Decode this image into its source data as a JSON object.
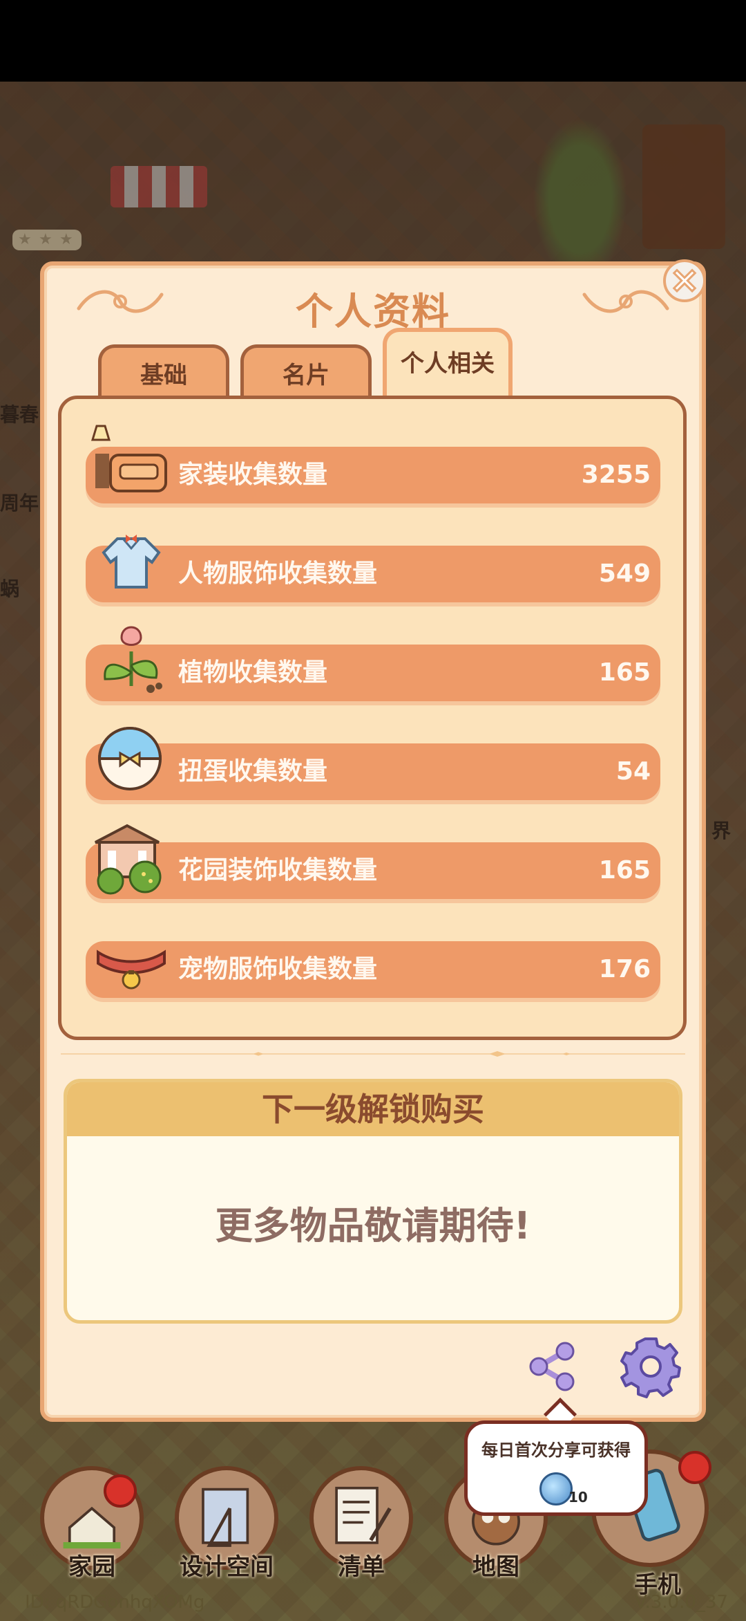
{
  "panel": {
    "title": "个人资料"
  },
  "side_labels": [
    "暮春",
    "周年",
    "蜗",
    "界"
  ],
  "tabs": [
    {
      "label": "基础",
      "active": false
    },
    {
      "label": "名片",
      "active": false
    },
    {
      "label": "个人相关",
      "active": true
    }
  ],
  "collection_rows": [
    {
      "label": "家装收集数量",
      "value": "3255",
      "icon": "sofa-lamp-icon"
    },
    {
      "label": "人物服饰收集数量",
      "value": "549",
      "icon": "shirt-icon"
    },
    {
      "label": "植物收集数量",
      "value": "165",
      "icon": "tulip-sprout-icon"
    },
    {
      "label": "扭蛋收集数量",
      "value": "54",
      "icon": "capsule-icon"
    },
    {
      "label": "花园装饰收集数量",
      "value": "165",
      "icon": "garden-pavilion-icon"
    },
    {
      "label": "宠物服饰收集数量",
      "value": "176",
      "icon": "pet-collar-icon"
    }
  ],
  "unlock": {
    "header": "下一级解锁购买",
    "body": "更多物品敬请期待!"
  },
  "tooltip": {
    "text": "每日首次分享可获得",
    "reward_count": "10"
  },
  "nav": [
    {
      "label": "家园"
    },
    {
      "label": "设计空间"
    },
    {
      "label": "清单"
    },
    {
      "label": "地图"
    },
    {
      "label": "手机"
    }
  ],
  "footer": {
    "id": "ID: qRDGonhqXOMg",
    "version": "V.3.0.0_37"
  },
  "colors": {
    "accent": "#ee9a68",
    "panel_bg": "#fdebd3",
    "border": "#a3613d",
    "title": "#d98a52"
  }
}
